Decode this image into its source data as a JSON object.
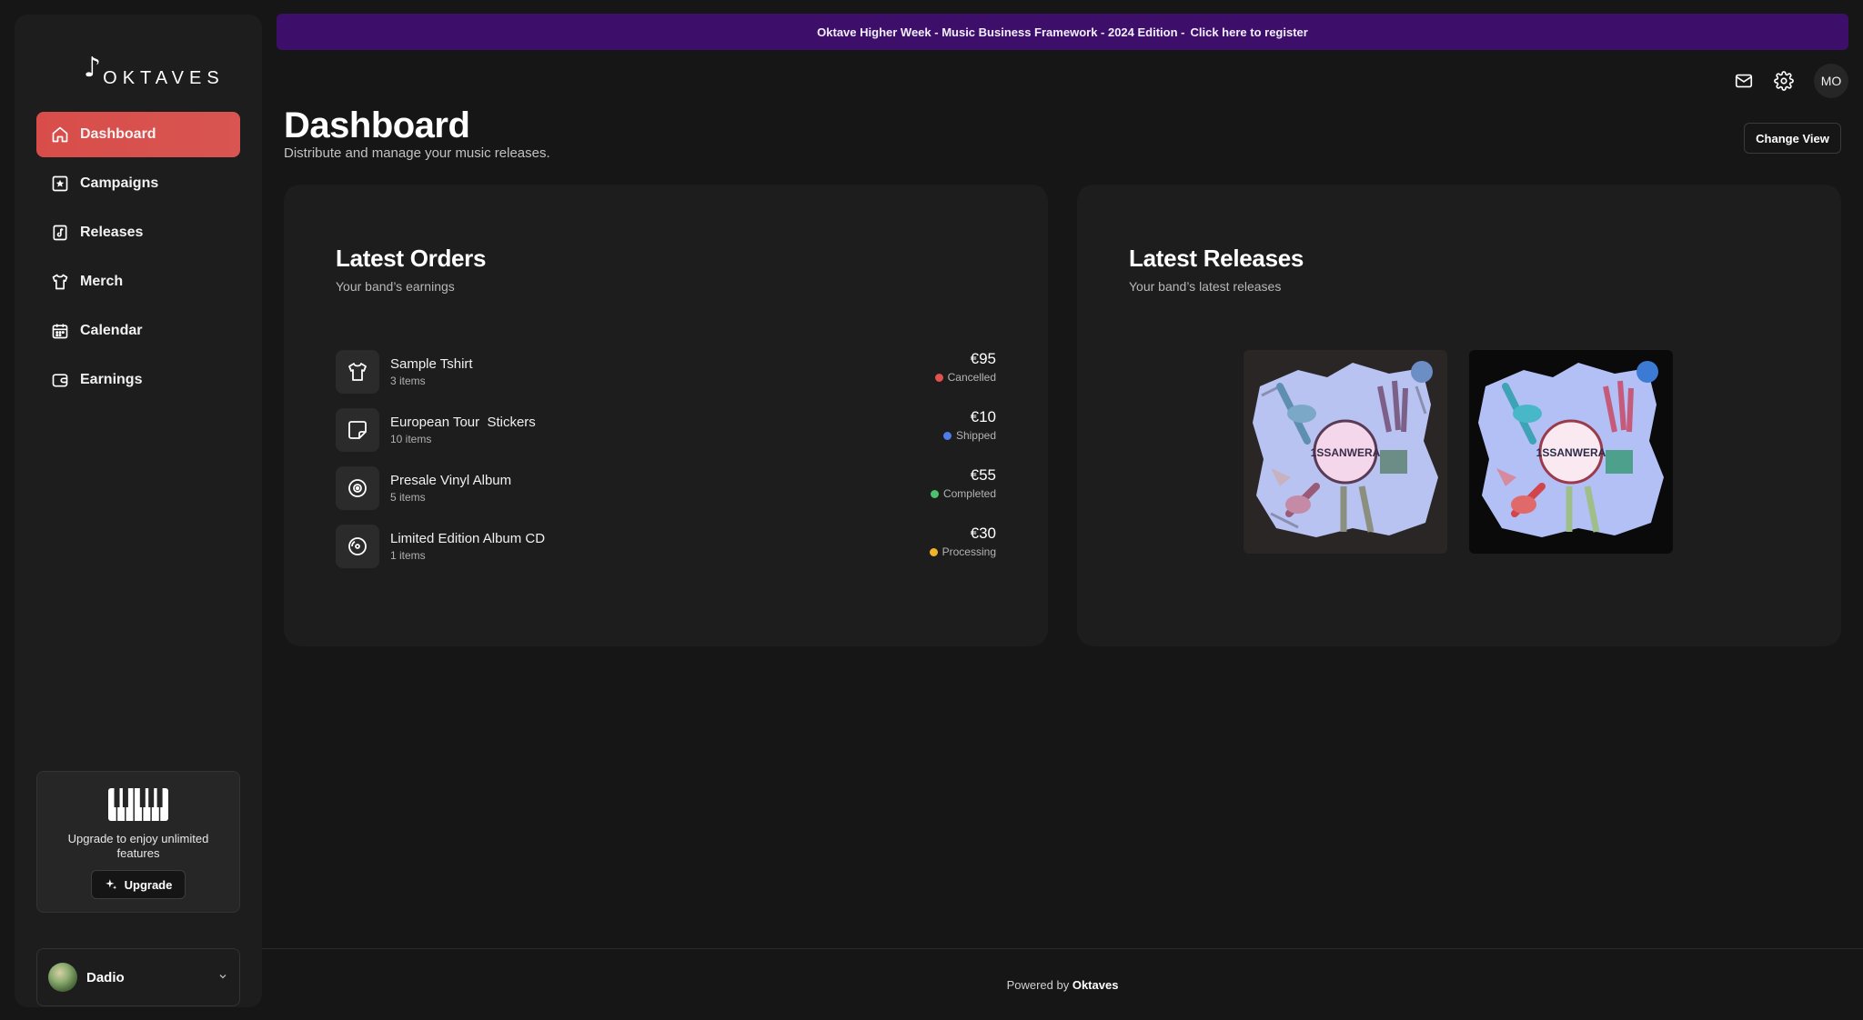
{
  "brand": {
    "name": "OKTAVES",
    "note_glyph": "♪"
  },
  "sidebar": {
    "items": [
      {
        "label": "Dashboard",
        "icon": "home-icon",
        "active": true
      },
      {
        "label": "Campaigns",
        "icon": "campaign-star-icon",
        "active": false
      },
      {
        "label": "Releases",
        "icon": "music-file-icon",
        "active": false
      },
      {
        "label": "Merch",
        "icon": "tshirt-icon",
        "active": false
      },
      {
        "label": "Calendar",
        "icon": "calendar-icon",
        "active": false
      },
      {
        "label": "Earnings",
        "icon": "wallet-icon",
        "active": false
      }
    ],
    "upgrade": {
      "text": "Upgrade to enjoy unlimited features",
      "button_label": "Upgrade"
    },
    "user": {
      "name": "Dadio"
    }
  },
  "banner": {
    "text": "Oktave Higher Week - Music Business Framework - 2024 Edition - ",
    "link": "Click here to register",
    "color": "#3d0f6b"
  },
  "header": {
    "avatar_initials": "MO",
    "title": "Dashboard",
    "subtitle": "Distribute and manage your music releases.",
    "change_view_label": "Change View"
  },
  "orders": {
    "title": "Latest Orders",
    "subtitle": "Your band’s earnings",
    "items": [
      {
        "name": "Sample Tshirt",
        "qty": "3 items",
        "price": "€95",
        "status": "Cancelled",
        "status_color": "#e0524e",
        "icon": "tshirt-icon"
      },
      {
        "name": "European Tour  Stickers",
        "qty": "10 items",
        "price": "€10",
        "status": "Shipped",
        "status_color": "#4f7bec",
        "icon": "sticker-icon"
      },
      {
        "name": "Presale Vinyl Album",
        "qty": "5 items",
        "price": "€55",
        "status": "Completed",
        "status_color": "#4cc06a",
        "icon": "vinyl-icon"
      },
      {
        "name": "Limited Edition Album CD",
        "qty": "1 items",
        "price": "€30",
        "status": "Processing",
        "status_color": "#f0b429",
        "icon": "cd-icon"
      }
    ]
  },
  "releases": {
    "title": "Latest Releases",
    "subtitle": "Your band’s latest releases",
    "covers": [
      {
        "art_text": "1SSANWERA"
      },
      {
        "art_text": "1SSANWERA"
      }
    ]
  },
  "footer": {
    "prefix": "Powered by ",
    "brand": "Oktaves"
  },
  "colors": {
    "accent": "#d84d4a",
    "background": "#161616",
    "panel": "#1d1d1d"
  }
}
